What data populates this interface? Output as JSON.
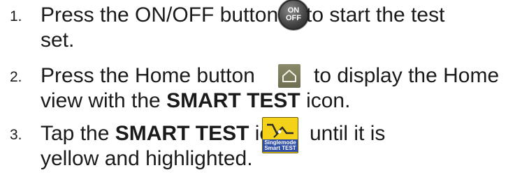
{
  "steps": [
    {
      "number": "1.",
      "line1_before": "Press the ON/OFF button",
      "line1_after": " to start the test",
      "line2": "set.",
      "icon": "power-onoff-icon",
      "icon_text_top": "ON",
      "icon_text_bottom": "OFF"
    },
    {
      "number": "2.",
      "line1_before": "Press the Home button",
      "line1_after": "to display the Home",
      "line2_before": "view with the ",
      "line2_bold": "SMART TEST",
      "line2_after": " icon.",
      "icon": "home-icon"
    },
    {
      "number": "3.",
      "line1_before": "Tap the ",
      "line1_bold": "SMART TEST",
      "line1_after_icon_lead": " icon",
      "line1_after": "until it is",
      "line2": "yellow and highlighted.",
      "icon": "smart-test-icon",
      "icon_label_1": "Singlemode",
      "icon_label_2": "Smart TEST"
    }
  ],
  "colors": {
    "text": "#1a1a1a",
    "smart_icon_bg": "#f4d21a",
    "smart_icon_label_bg": "#2f4fa8"
  }
}
